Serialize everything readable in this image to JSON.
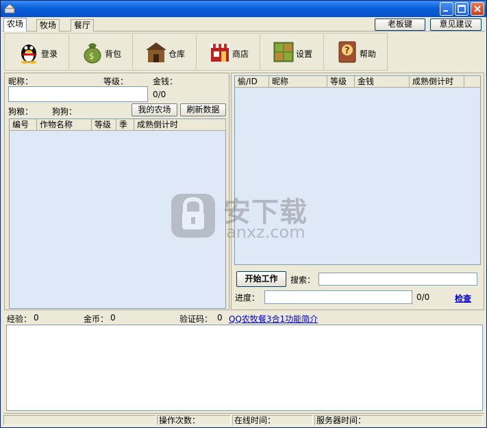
{
  "tabs": [
    {
      "label": "农场",
      "active": true
    },
    {
      "label": "牧场",
      "active": false
    },
    {
      "label": "餐厅",
      "active": false
    }
  ],
  "top_buttons": {
    "boss_key": "老板键",
    "feedback": "意见建议"
  },
  "toolbar": [
    {
      "label": "登录",
      "icon": "penguin-icon"
    },
    {
      "label": "背包",
      "icon": "money-bag-icon"
    },
    {
      "label": "仓库",
      "icon": "warehouse-icon"
    },
    {
      "label": "商店",
      "icon": "shop-icon"
    },
    {
      "label": "设置",
      "icon": "settings-icon"
    },
    {
      "label": "帮助",
      "icon": "help-book-icon"
    }
  ],
  "left": {
    "nickname_label": "昵称：",
    "level_label": "等级：",
    "money_label": "金钱：",
    "progress_value": "0/0",
    "dog_food_label": "狗粮：",
    "dog_label": "狗狗：",
    "my_farm_button": "我的农场",
    "refresh_button": "刷新数据",
    "columns": [
      "编号",
      "作物名称",
      "等级",
      "季",
      "成熟倒计时"
    ]
  },
  "right": {
    "columns": [
      "偷/ID",
      "昵称",
      "等级",
      "金钱",
      "成熟倒计时"
    ],
    "start_button": "开始工作",
    "search_label": "搜索：",
    "search_value": "",
    "progress_label": "进度：",
    "progress_value": "0/0",
    "check_link": "检查"
  },
  "info": {
    "exp_label": "经验：",
    "exp_value": "0",
    "gold_label": "金币：",
    "gold_value": "0",
    "captcha_label": "验证码：",
    "captcha_value": "0",
    "intro_link": "QQ农牧餐3合1功能简介"
  },
  "status": {
    "ops_label": "操作次数：",
    "online_label": "在线时间：",
    "server_label": "服务器时间："
  },
  "watermark": {
    "main": "安下载",
    "sub": "anxz.com"
  },
  "colors": {
    "titlebar": "#0550cc",
    "grid_bg": "#dfe8f6",
    "link": "#0000cc",
    "window_bg": "#ece9d8"
  }
}
